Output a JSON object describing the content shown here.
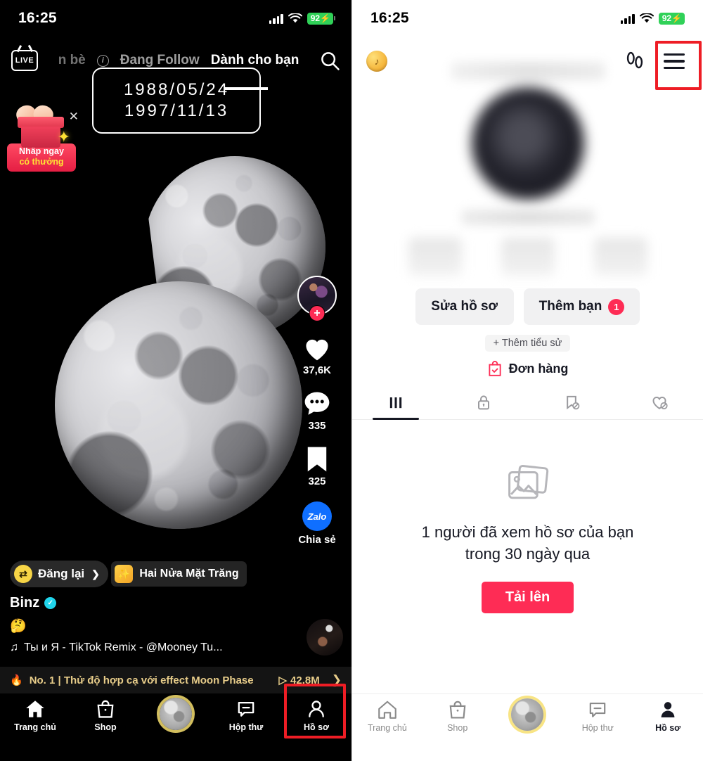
{
  "status_bar": {
    "time": "16:25",
    "battery": "92",
    "battery_charging": true,
    "signal_icon": "cellular-bars-icon",
    "wifi_icon": "wifi-icon"
  },
  "feed": {
    "nav": {
      "live_label": "LIVE",
      "friends_label": "n bè",
      "info_icon": "info-circle-icon",
      "following_label": "Đang Follow",
      "foryou_label": "Dành cho bạn",
      "search_icon": "search-icon"
    },
    "date_overlay": {
      "line1": "1988/05/24",
      "line2": "1997/11/13"
    },
    "gift": {
      "line1": "Nhấp ngay",
      "line2": "có thưởng",
      "close_icon": "close-icon",
      "gift_icon": "gift-box-icon"
    },
    "rail": {
      "avatar_icon": "creator-avatar",
      "follow_plus": "+",
      "like_icon": "heart-icon",
      "like_count": "37,6K",
      "comment_icon": "comment-icon",
      "comment_count": "335",
      "save_icon": "bookmark-icon",
      "save_count": "325",
      "share_icon": "zalo-icon",
      "share_brand": "Zalo",
      "share_label": "Chia sẻ"
    },
    "caption": {
      "repost_label": "Đăng lại",
      "repost_icon": "repost-icon",
      "repost_chevron": "❯",
      "effect_label": "Hai Nửa Mặt Trăng",
      "effect_icon": "effect-magic-icon",
      "username": "Binz",
      "verified_icon": "verified-badge-icon",
      "emoji": "🤔",
      "music_icon": "music-note-icon",
      "music_label": "Ты и Я - TikTok Remix - @Mooney Tu..."
    },
    "trending": {
      "fire_icon": "flame-icon",
      "label": "No. 1 | Thử độ hợp cạ với effect Moon Phase",
      "play_icon": "play-triangle-icon",
      "views": "42,8M",
      "chevron": "❯"
    },
    "tabbar": [
      {
        "label": "Trang chủ",
        "icon": "home-icon",
        "active": true
      },
      {
        "label": "Shop",
        "icon": "shop-bag-icon",
        "active": false
      },
      {
        "label": "",
        "icon": "moon-create-icon",
        "active": false
      },
      {
        "label": "Hộp thư",
        "icon": "inbox-message-icon",
        "active": false
      },
      {
        "label": "Hồ sơ",
        "icon": "profile-person-icon",
        "active": false,
        "highlighted": true
      }
    ]
  },
  "profile": {
    "top": {
      "coin_icon": "coin-icon",
      "footprint_icon": "footprint-icon",
      "menu_icon": "hamburger-menu-icon",
      "menu_highlighted": true
    },
    "buttons": {
      "edit_profile": "Sửa hồ sơ",
      "add_friend": "Thêm bạn",
      "add_friend_badge": "1",
      "add_bio": "+ Thêm tiểu sử",
      "orders": "Đơn hàng",
      "orders_icon": "order-bag-icon"
    },
    "tabs": [
      {
        "icon": "grid-posts-icon",
        "active": true
      },
      {
        "icon": "lock-private-icon",
        "active": false
      },
      {
        "icon": "bookmark-hidden-icon",
        "active": false
      },
      {
        "icon": "heart-hidden-icon",
        "active": false
      }
    ],
    "empty_state": {
      "icon": "photos-placeholder-icon",
      "line1": "1 người đã xem hồ sơ của bạn",
      "line2": "trong 30 ngày qua",
      "upload_label": "Tải lên"
    },
    "tabbar": [
      {
        "label": "Trang chủ",
        "icon": "home-icon",
        "active": false
      },
      {
        "label": "Shop",
        "icon": "shop-bag-icon",
        "active": false
      },
      {
        "label": "",
        "icon": "moon-create-icon",
        "active": false
      },
      {
        "label": "Hộp thư",
        "icon": "inbox-message-icon",
        "active": false
      },
      {
        "label": "Hồ sơ",
        "icon": "profile-person-icon",
        "active": true
      }
    ]
  },
  "colors": {
    "accent_red": "#fe2c55",
    "highlight_red": "#ee1d25",
    "battery_green": "#30d158",
    "trend_gold": "#e8cd8a",
    "zalo_blue": "#0f6fff"
  }
}
